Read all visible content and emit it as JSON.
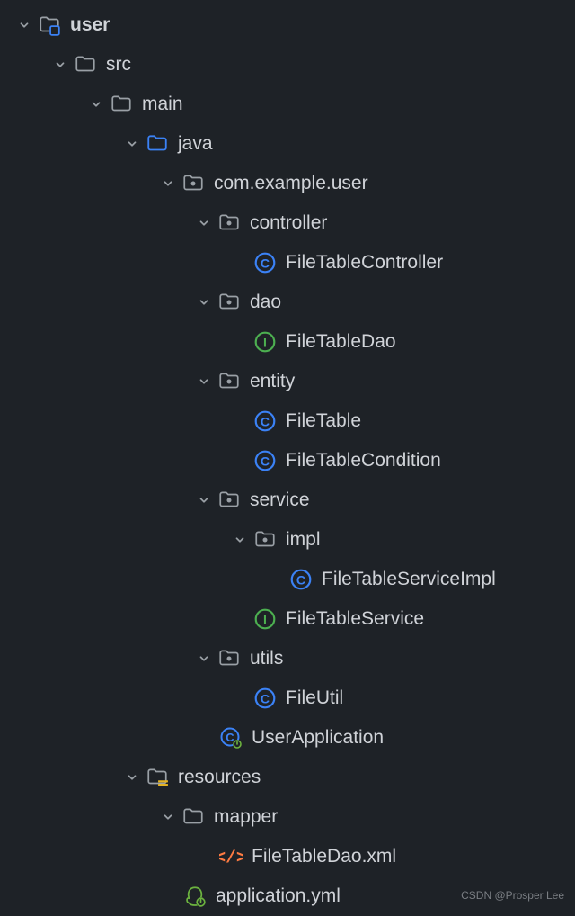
{
  "watermark": "CSDN @Prosper Lee",
  "nodes": [
    {
      "indent": 18,
      "chevron": true,
      "icon": "module-folder",
      "label": "user",
      "bold": true,
      "name": "folder-user"
    },
    {
      "indent": 58,
      "chevron": true,
      "icon": "folder",
      "label": "src",
      "name": "folder-src"
    },
    {
      "indent": 98,
      "chevron": true,
      "icon": "folder",
      "label": "main",
      "name": "folder-main"
    },
    {
      "indent": 138,
      "chevron": true,
      "icon": "source-folder",
      "label": "java",
      "name": "folder-java"
    },
    {
      "indent": 178,
      "chevron": true,
      "icon": "package",
      "label": "com.example.user",
      "name": "package-com-example-user"
    },
    {
      "indent": 218,
      "chevron": true,
      "icon": "package",
      "label": "controller",
      "name": "package-controller"
    },
    {
      "indent": 282,
      "chevron": false,
      "icon": "class",
      "label": "FileTableController",
      "name": "class-file-table-controller"
    },
    {
      "indent": 218,
      "chevron": true,
      "icon": "package",
      "label": "dao",
      "name": "package-dao"
    },
    {
      "indent": 282,
      "chevron": false,
      "icon": "interface",
      "label": "FileTableDao",
      "name": "interface-file-table-dao"
    },
    {
      "indent": 218,
      "chevron": true,
      "icon": "package",
      "label": "entity",
      "name": "package-entity"
    },
    {
      "indent": 282,
      "chevron": false,
      "icon": "class",
      "label": "FileTable",
      "name": "class-file-table"
    },
    {
      "indent": 282,
      "chevron": false,
      "icon": "class",
      "label": "FileTableCondition",
      "name": "class-file-table-condition"
    },
    {
      "indent": 218,
      "chevron": true,
      "icon": "package",
      "label": "service",
      "name": "package-service"
    },
    {
      "indent": 258,
      "chevron": true,
      "icon": "package",
      "label": "impl",
      "name": "package-impl"
    },
    {
      "indent": 322,
      "chevron": false,
      "icon": "class",
      "label": "FileTableServiceImpl",
      "name": "class-file-table-service-impl"
    },
    {
      "indent": 282,
      "chevron": false,
      "icon": "interface",
      "label": "FileTableService",
      "name": "interface-file-table-service"
    },
    {
      "indent": 218,
      "chevron": true,
      "icon": "package",
      "label": "utils",
      "name": "package-utils"
    },
    {
      "indent": 282,
      "chevron": false,
      "icon": "class",
      "label": "FileUtil",
      "name": "class-file-util"
    },
    {
      "indent": 244,
      "chevron": false,
      "icon": "spring-class",
      "label": "UserApplication",
      "name": "class-user-application"
    },
    {
      "indent": 138,
      "chevron": true,
      "icon": "resources",
      "label": "resources",
      "name": "folder-resources"
    },
    {
      "indent": 178,
      "chevron": true,
      "icon": "folder",
      "label": "mapper",
      "name": "folder-mapper"
    },
    {
      "indent": 244,
      "chevron": false,
      "icon": "xml",
      "label": "FileTableDao.xml",
      "name": "file-file-table-dao-xml"
    },
    {
      "indent": 204,
      "chevron": false,
      "icon": "spring-yml",
      "label": "application.yml",
      "name": "file-application-yml"
    }
  ]
}
